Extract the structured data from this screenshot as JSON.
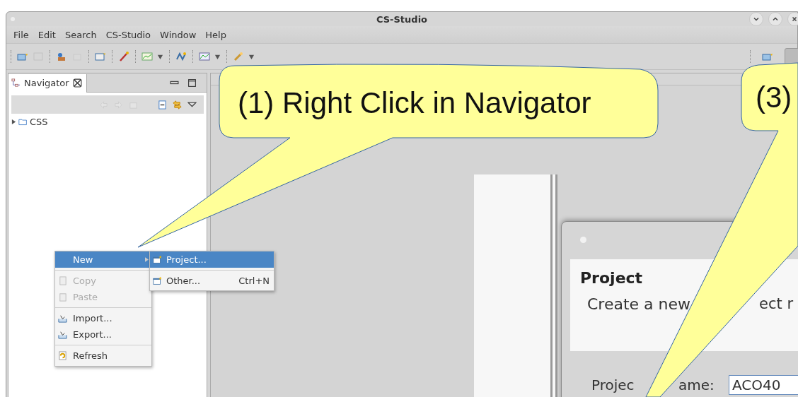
{
  "window": {
    "title": "CS-Studio"
  },
  "menu_bar": [
    "File",
    "Edit",
    "Search",
    "CS-Studio",
    "Window",
    "Help"
  ],
  "navigator": {
    "tab": {
      "label": "Navigator",
      "selected": true
    },
    "tree": [
      {
        "label": "CSS",
        "expanded": false
      }
    ]
  },
  "context_menu": [
    {
      "kind": "item",
      "label": "New",
      "selected": true,
      "disabled": false,
      "submenu": true
    },
    {
      "kind": "separator"
    },
    {
      "kind": "item",
      "label": "Copy",
      "selected": false,
      "disabled": true,
      "submenu": false
    },
    {
      "kind": "item",
      "label": "Paste",
      "selected": false,
      "disabled": true,
      "submenu": false
    },
    {
      "kind": "separator"
    },
    {
      "kind": "item",
      "label": "Import...",
      "selected": false,
      "disabled": false,
      "submenu": false
    },
    {
      "kind": "item",
      "label": "Export...",
      "selected": false,
      "disabled": false,
      "submenu": false
    },
    {
      "kind": "separator"
    },
    {
      "kind": "item",
      "label": "Refresh",
      "selected": false,
      "disabled": false,
      "submenu": false
    }
  ],
  "submenu": [
    {
      "kind": "item",
      "label": "Project...",
      "selected": true
    },
    {
      "kind": "separator"
    },
    {
      "kind": "item",
      "label": "Other...",
      "selected": false,
      "shortcut": "Ctrl+N"
    }
  ],
  "dialog": {
    "heading": "Project",
    "description_parts": [
      "Create a new",
      "ect r"
    ],
    "name_label_parts": [
      "Projec",
      "ame:"
    ],
    "name_value": "ACO40"
  },
  "callouts": [
    {
      "text": "(1) Right Click in Navigator"
    },
    {
      "text": "(3)"
    }
  ]
}
